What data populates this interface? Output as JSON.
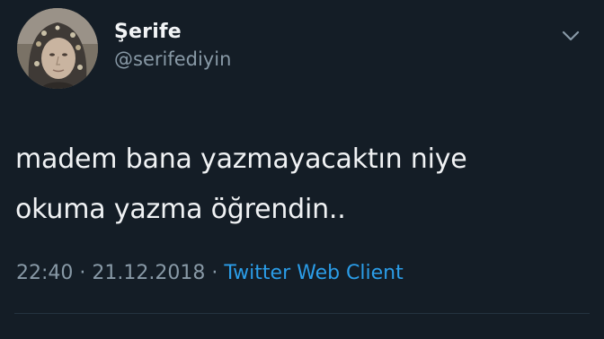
{
  "tweet": {
    "author": {
      "display_name": "Şerife",
      "handle": "@serifediyin"
    },
    "text_lines": [
      "madem bana yazmayacaktın niye",
      "okuma yazma öğrendin.."
    ],
    "meta": {
      "time": "22:40",
      "separator": "·",
      "date": "21.12.2018",
      "client": "Twitter Web Client"
    }
  },
  "icons": {
    "avatar": "profile-photo",
    "menu": "chevron-down-icon"
  },
  "colors": {
    "background": "#141d26",
    "text": "#ffffff",
    "secondary_text": "#8899a6",
    "link": "#2b9de8"
  }
}
